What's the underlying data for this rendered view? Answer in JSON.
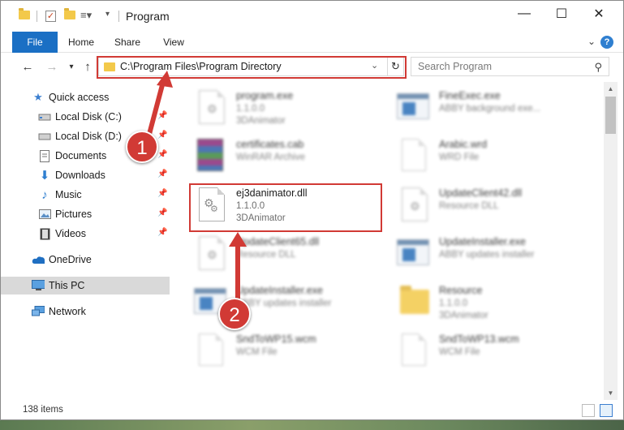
{
  "window": {
    "title": "Program",
    "controls": {
      "minimize": "—",
      "maximize": "☐",
      "close": "✕"
    }
  },
  "ribbon": {
    "tabs": [
      "File",
      "Home",
      "Share",
      "View"
    ],
    "help": "?"
  },
  "navigation": {
    "back": "←",
    "forward": "→",
    "recent": "▾",
    "up": "↑",
    "address_path": "C:\\Program Files\\Program Directory",
    "search_placeholder": "Search Program"
  },
  "sidebar": {
    "quick_access": "Quick access",
    "items": [
      {
        "label": "Local Disk (C:)",
        "icon": "drive-icon"
      },
      {
        "label": "Local Disk (D:)",
        "icon": "drive-icon"
      },
      {
        "label": "Documents",
        "icon": "documents-icon"
      },
      {
        "label": "Downloads",
        "icon": "downloads-icon"
      },
      {
        "label": "Music",
        "icon": "music-icon"
      },
      {
        "label": "Pictures",
        "icon": "pictures-icon"
      },
      {
        "label": "Videos",
        "icon": "videos-icon"
      }
    ],
    "onedrive": "OneDrive",
    "this_pc": "This PC",
    "network": "Network"
  },
  "files": [
    {
      "name": "program.exe",
      "meta1": "1.1.0.0",
      "meta2": "3DAnimator",
      "type": "exe"
    },
    {
      "name": "FineExec.exe",
      "meta1": "ABBY background exe...",
      "meta2": "",
      "type": "app"
    },
    {
      "name": "certificates.cab",
      "meta1": "WinRAR Archive",
      "meta2": "",
      "type": "rar"
    },
    {
      "name": "Arabic.wrd",
      "meta1": "WRD File",
      "meta2": "",
      "type": "doc"
    },
    {
      "name": "ej3danimator.dll",
      "meta1": "1.1.0.0",
      "meta2": "3DAnimator",
      "type": "dll",
      "highlighted": true
    },
    {
      "name": "UpdateClient42.dll",
      "meta1": "Resource DLL",
      "meta2": "",
      "type": "dll-gear"
    },
    {
      "name": "UpdateClient65.dll",
      "meta1": "Resource DLL",
      "meta2": "",
      "type": "dll-gear"
    },
    {
      "name": "UpdateInstaller.exe",
      "meta1": "ABBY updates installer",
      "meta2": "",
      "type": "app"
    },
    {
      "name": "UpdateInstaller.exe",
      "meta1": "ABBY updates installer",
      "meta2": "",
      "type": "app"
    },
    {
      "name": "Resource",
      "meta1": "1.1.0.0",
      "meta2": "3DAnimator",
      "type": "folder"
    },
    {
      "name": "SndToWP15.wcm",
      "meta1": "WCM File",
      "meta2": "",
      "type": "doc"
    },
    {
      "name": "SndToWP13.wcm",
      "meta1": "WCM File",
      "meta2": "",
      "type": "doc"
    }
  ],
  "status": {
    "item_count": "138 items"
  },
  "annotations": [
    {
      "number": "1",
      "color": "#d13a35"
    },
    {
      "number": "2",
      "color": "#d13a35"
    }
  ],
  "colors": {
    "accent": "#1a6fc4",
    "highlight": "#d13a35",
    "selected": "#d9d9d9"
  }
}
